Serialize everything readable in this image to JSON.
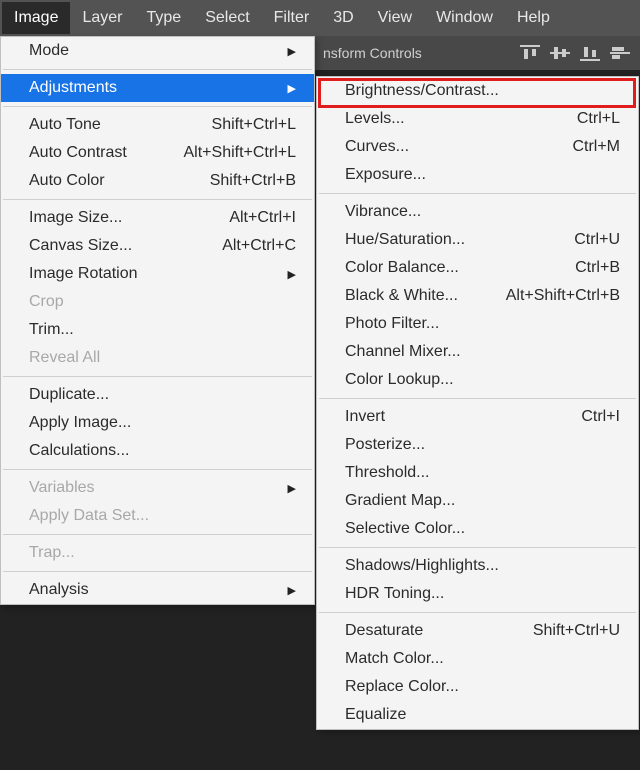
{
  "menubar": {
    "items": [
      "Image",
      "Layer",
      "Type",
      "Select",
      "Filter",
      "3D",
      "View",
      "Window",
      "Help"
    ],
    "active_index": 0
  },
  "tool_options": {
    "label": "nsform Controls"
  },
  "image_menu": {
    "items": [
      {
        "label": "Mode",
        "submenu": true
      },
      {
        "sep": true
      },
      {
        "label": "Adjustments",
        "submenu": true,
        "highlight": true
      },
      {
        "sep": true
      },
      {
        "label": "Auto Tone",
        "shortcut": "Shift+Ctrl+L"
      },
      {
        "label": "Auto Contrast",
        "shortcut": "Alt+Shift+Ctrl+L"
      },
      {
        "label": "Auto Color",
        "shortcut": "Shift+Ctrl+B"
      },
      {
        "sep": true
      },
      {
        "label": "Image Size...",
        "shortcut": "Alt+Ctrl+I"
      },
      {
        "label": "Canvas Size...",
        "shortcut": "Alt+Ctrl+C"
      },
      {
        "label": "Image Rotation",
        "submenu": true
      },
      {
        "label": "Crop",
        "disabled": true
      },
      {
        "label": "Trim..."
      },
      {
        "label": "Reveal All",
        "disabled": true
      },
      {
        "sep": true
      },
      {
        "label": "Duplicate..."
      },
      {
        "label": "Apply Image..."
      },
      {
        "label": "Calculations..."
      },
      {
        "sep": true
      },
      {
        "label": "Variables",
        "submenu": true,
        "disabled": true
      },
      {
        "label": "Apply Data Set...",
        "disabled": true
      },
      {
        "sep": true
      },
      {
        "label": "Trap...",
        "disabled": true
      },
      {
        "sep": true
      },
      {
        "label": "Analysis",
        "submenu": true
      }
    ]
  },
  "adjustments_menu": {
    "items": [
      {
        "label": "Brightness/Contrast...",
        "outlined": true
      },
      {
        "label": "Levels...",
        "shortcut": "Ctrl+L"
      },
      {
        "label": "Curves...",
        "shortcut": "Ctrl+M"
      },
      {
        "label": "Exposure..."
      },
      {
        "sep": true
      },
      {
        "label": "Vibrance..."
      },
      {
        "label": "Hue/Saturation...",
        "shortcut": "Ctrl+U"
      },
      {
        "label": "Color Balance...",
        "shortcut": "Ctrl+B"
      },
      {
        "label": "Black & White...",
        "shortcut": "Alt+Shift+Ctrl+B"
      },
      {
        "label": "Photo Filter..."
      },
      {
        "label": "Channel Mixer..."
      },
      {
        "label": "Color Lookup..."
      },
      {
        "sep": true
      },
      {
        "label": "Invert",
        "shortcut": "Ctrl+I"
      },
      {
        "label": "Posterize..."
      },
      {
        "label": "Threshold..."
      },
      {
        "label": "Gradient Map..."
      },
      {
        "label": "Selective Color..."
      },
      {
        "sep": true
      },
      {
        "label": "Shadows/Highlights..."
      },
      {
        "label": "HDR Toning..."
      },
      {
        "sep": true
      },
      {
        "label": "Desaturate",
        "shortcut": "Shift+Ctrl+U"
      },
      {
        "label": "Match Color..."
      },
      {
        "label": "Replace Color..."
      },
      {
        "label": "Equalize"
      }
    ]
  }
}
